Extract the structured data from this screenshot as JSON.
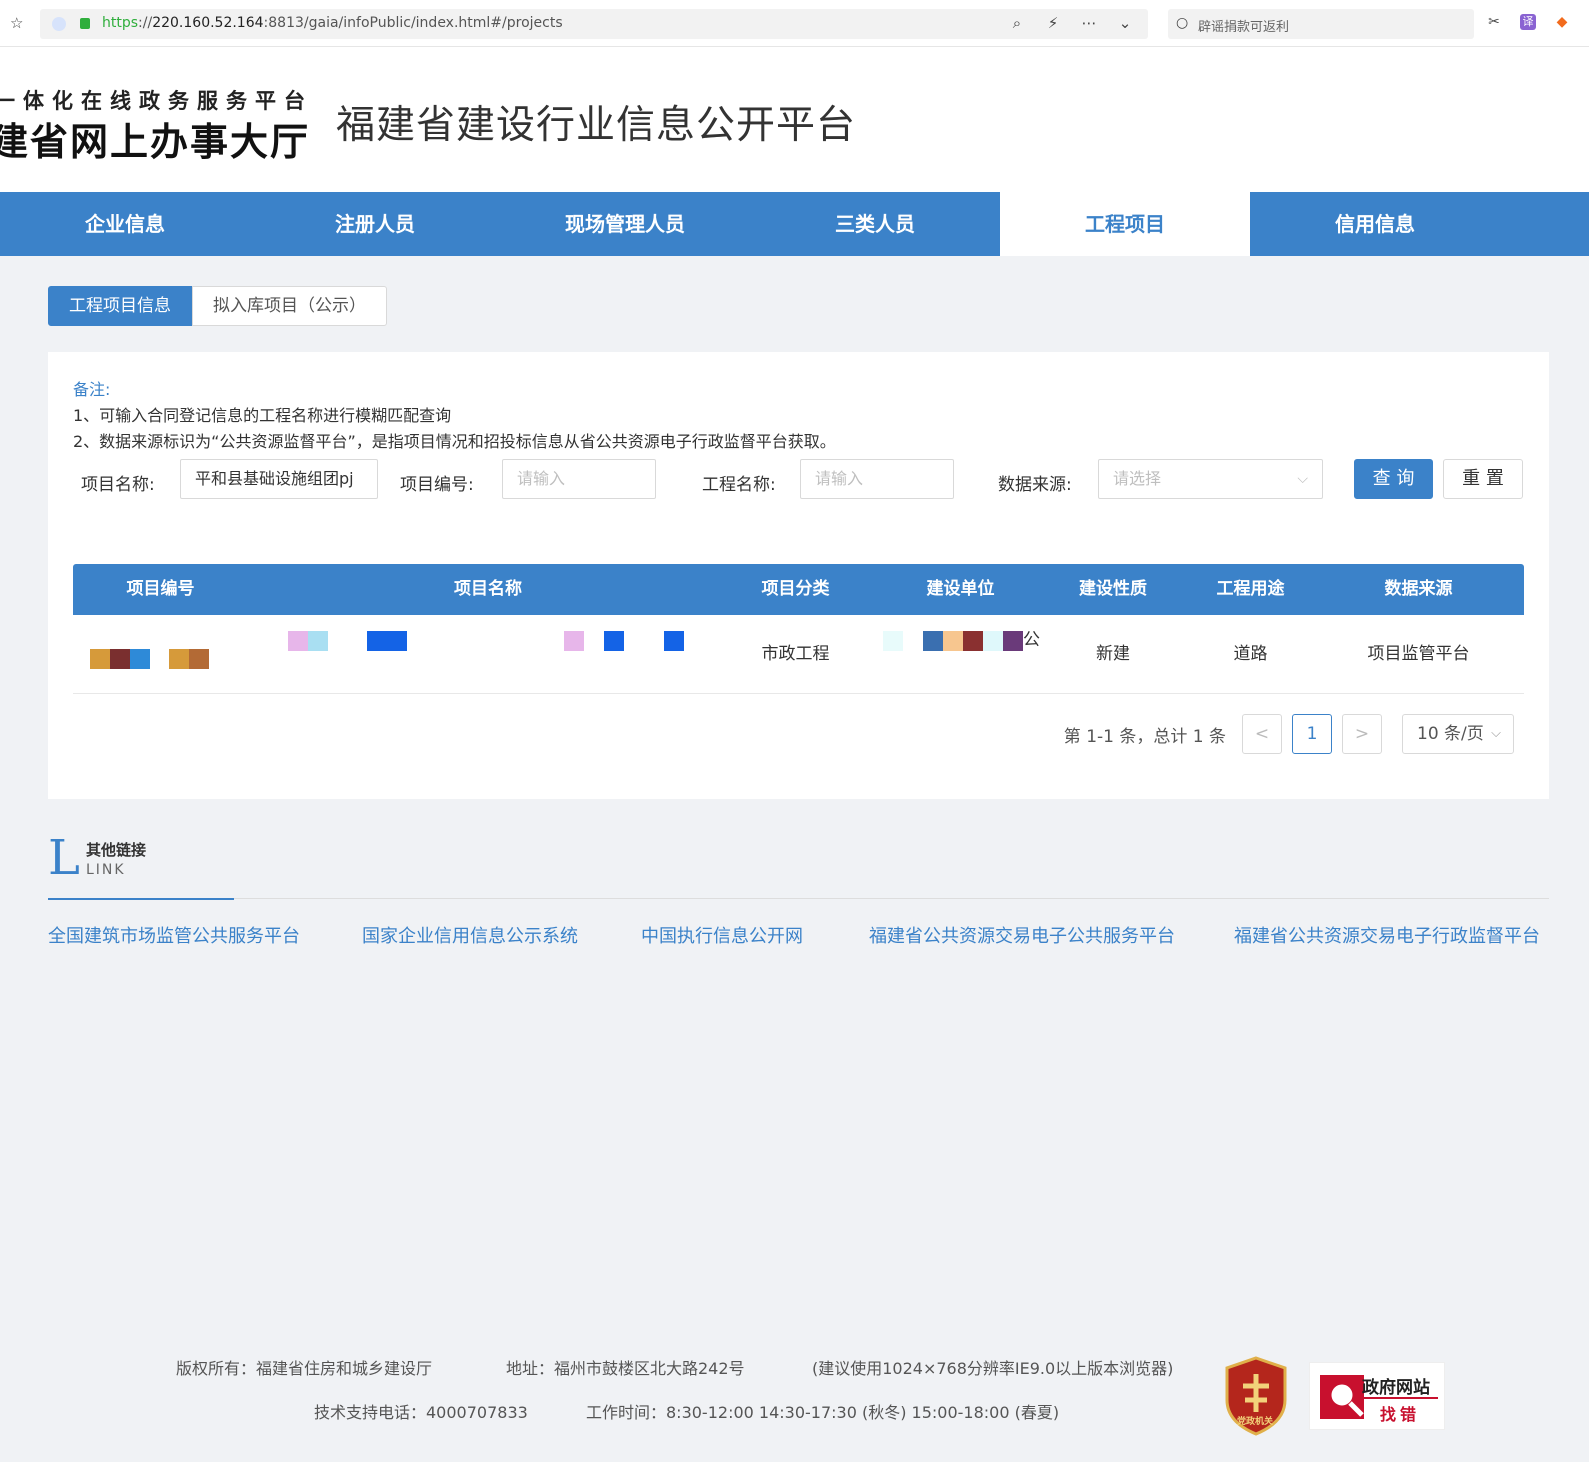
{
  "browser": {
    "url_scheme": "https",
    "url_host": "220.160.52.164",
    "url_rest": ":8813/gaia/infoPublic/index.html#/projects",
    "search_text": "辟谣捐款可返利"
  },
  "header": {
    "logo_line1": "一体化在线政务服务平台",
    "logo_line2": "建省网上办事大厅",
    "site_title": "福建省建设行业信息公开平台"
  },
  "nav": {
    "items": [
      {
        "label": "企业信息"
      },
      {
        "label": "注册人员"
      },
      {
        "label": "现场管理人员"
      },
      {
        "label": "三类人员"
      },
      {
        "label": "工程项目"
      },
      {
        "label": "信用信息"
      }
    ],
    "active_index": 4
  },
  "sub_tabs": {
    "tab1": "工程项目信息",
    "tab2": "拟入库项目（公示）"
  },
  "note": {
    "title": "备注:",
    "line1": "1、可输入合同登记信息的工程名称进行模糊匹配查询",
    "line2": "2、数据来源标识为“公共资源监督平台”，是指项目情况和招投标信息从省公共资源电子行政监督平台获取。"
  },
  "filters": {
    "project_name_label": "项目名称:",
    "project_name_value": "平和县基础设施组团pj",
    "project_no_label": "项目编号:",
    "project_no_placeholder": "请输入",
    "work_name_label": "工程名称:",
    "work_name_placeholder": "请输入",
    "source_label": "数据来源:",
    "source_placeholder": "请选择",
    "query_button": "查 询",
    "reset_button": "重 置"
  },
  "table": {
    "columns": [
      "项目编号",
      "项目名称",
      "项目分类",
      "建设单位",
      "建设性质",
      "工程用途",
      "数据来源"
    ],
    "rows": [
      {
        "category": "市政工程",
        "builder_suffix": "公",
        "nature": "新建",
        "usage": "道路",
        "source": "项目监管平台"
      }
    ]
  },
  "pager": {
    "total_text": "第 1-1 条，总计 1 条",
    "prev": "<",
    "current_page": "1",
    "next": ">",
    "page_size": "10 条/页"
  },
  "links": {
    "title_cn": "其他链接",
    "title_en": "LINK",
    "letter": "L",
    "items": [
      "全国建筑市场监管公共服务平台",
      "国家企业信用信息公示系统",
      "中国执行信息公开网",
      "福建省公共资源交易电子公共服务平台",
      "福建省公共资源交易电子行政监督平台"
    ]
  },
  "footer": {
    "copyright": "版权所有：福建省住房和城乡建设厅",
    "address": "地址：福州市鼓楼区北大路242号",
    "browser_hint": "(建议使用1024×768分辨率IE9.0以上版本浏览器)",
    "phone": "技术支持电话：4000707833",
    "hours": "工作时间：8:30-12:00 14:30-17:30 (秋冬) 15:00-18:00 (春夏)",
    "badge1_text": "党政机关",
    "badge2_line1": "政府网站",
    "badge2_line2": "找错"
  },
  "colors": {
    "primary": "#3b82c9",
    "page_bg": "#f0f2f5"
  }
}
